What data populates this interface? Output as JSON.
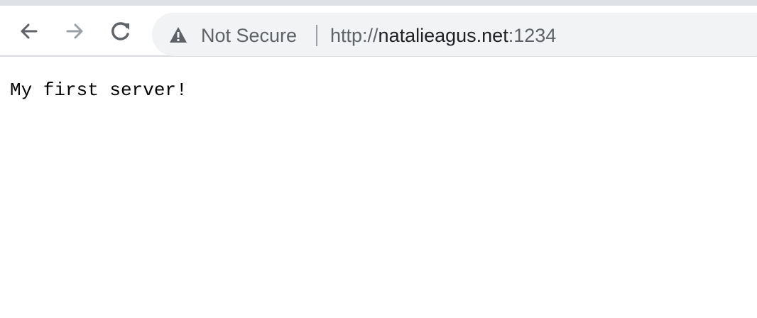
{
  "toolbar": {
    "back_icon": "arrow-left-icon",
    "forward_icon": "arrow-right-icon",
    "reload_icon": "reload-icon"
  },
  "omnibox": {
    "security_icon": "warning-triangle-icon",
    "security_label": "Not Secure",
    "url_scheme": "http://",
    "url_host": "natalieagus.net",
    "url_port": ":1234"
  },
  "page": {
    "text": "My first server!"
  },
  "colors": {
    "toolbar_bg": "#ffffff",
    "omnibox_bg": "#f1f3f4",
    "icon_gray": "#5f6368",
    "disabled_gray": "#9aa0a6",
    "text_dark": "#202124"
  }
}
